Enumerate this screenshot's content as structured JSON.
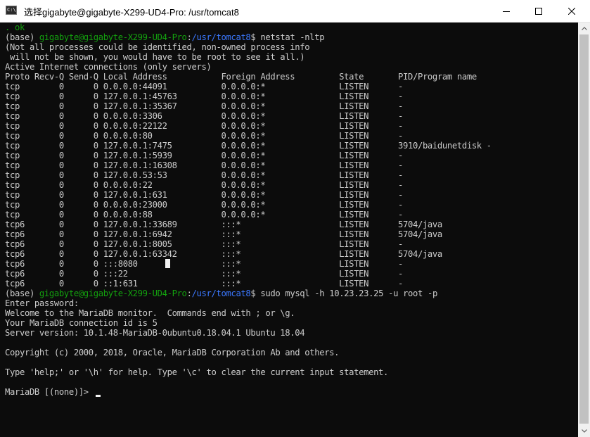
{
  "window": {
    "title": "选择gigabyte@gigabyte-X299-UD4-Pro: /usr/tomcat8",
    "icon_label": "C:\\",
    "icons": {
      "app": "terminal-app-icon",
      "minimize": "minimize-icon",
      "maximize": "maximize-icon",
      "close": "close-icon"
    }
  },
  "terminal": {
    "fragment": ". ok",
    "prompt1": {
      "prefix": "(base) ",
      "user_host": "gigabyte@gigabyte-X299-UD4-Pro",
      "sep": ":",
      "path": "/usr/tomcat8",
      "sign": "$ ",
      "command": "netstat -nltp"
    },
    "notice": [
      "(Not all processes could be identified, non-owned process info",
      " will not be shown, you would have to be root to see it all.)",
      "Active Internet connections (only servers)"
    ],
    "header": "Proto Recv-Q Send-Q Local Address           Foreign Address         State       PID/Program name",
    "rows": [
      "tcp        0      0 0.0.0.0:44091           0.0.0.0:*               LISTEN      -",
      "tcp        0      0 127.0.0.1:45763         0.0.0.0:*               LISTEN      -",
      "tcp        0      0 127.0.0.1:35367         0.0.0.0:*               LISTEN      -",
      "tcp        0      0 0.0.0.0:3306            0.0.0.0:*               LISTEN      -",
      "tcp        0      0 0.0.0.0:22122           0.0.0.0:*               LISTEN      -",
      "tcp        0      0 0.0.0.0:80              0.0.0.0:*               LISTEN      -",
      "tcp        0      0 127.0.0.1:7475          0.0.0.0:*               LISTEN      3910/baidunetdisk -",
      "tcp        0      0 127.0.0.1:5939          0.0.0.0:*               LISTEN      -",
      "tcp        0      0 127.0.0.1:16308         0.0.0.0:*               LISTEN      -",
      "tcp        0      0 127.0.0.53:53           0.0.0.0:*               LISTEN      -",
      "tcp        0      0 0.0.0.0:22              0.0.0.0:*               LISTEN      -",
      "tcp        0      0 127.0.0.1:631           0.0.0.0:*               LISTEN      -",
      "tcp        0      0 0.0.0.0:23000           0.0.0.0:*               LISTEN      -",
      "tcp        0      0 0.0.0.0:88              0.0.0.0:*               LISTEN      -",
      "tcp6       0      0 127.0.0.1:33689         :::*                    LISTEN      5704/java",
      "tcp6       0      0 127.0.0.1:6942          :::*                    LISTEN      5704/java",
      "tcp6       0      0 127.0.0.1:8005          :::*                    LISTEN      -",
      "tcp6       0      0 127.0.0.1:63342         :::*                    LISTEN      5704/java",
      "tcp6       0      0 :::8080                 :::*                    LISTEN      -",
      "tcp6       0      0 :::22                   :::*                    LISTEN      -",
      "tcp6       0      0 ::1:631                 :::*                    LISTEN      -"
    ],
    "prompt2": {
      "prefix": "(base) ",
      "user_host": "gigabyte@gigabyte-X299-UD4-Pro",
      "sep": ":",
      "path": "/usr/tomcat8",
      "sign": "$ ",
      "command": "sudo mysql -h 10.23.23.25 -u root -p"
    },
    "mysql": [
      "Enter password:",
      "Welcome to the MariaDB monitor.  Commands end with ; or \\g.",
      "Your MariaDB connection id is 5",
      "Server version: 10.1.48-MariaDB-0ubuntu0.18.04.1 Ubuntu 18.04",
      "",
      "Copyright (c) 2000, 2018, Oracle, MariaDB Corporation Ab and others.",
      "",
      "Type 'help;' or '\\h' for help. Type '\\c' to clear the current input statement.",
      ""
    ],
    "final_prompt": "MariaDB [(none)]> "
  },
  "scrollbar": {
    "up": "chevron-up-icon",
    "down": "chevron-down-icon"
  },
  "colors": {
    "background": "#0c0c0c",
    "text": "#cccccc",
    "prompt_user": "#13a10e",
    "prompt_path": "#3b78ff"
  }
}
